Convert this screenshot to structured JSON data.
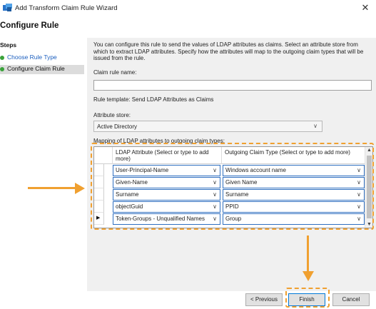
{
  "window": {
    "title": "Add Transform Claim Rule Wizard",
    "close_glyph": "✕",
    "icon": "wizard-app-icon"
  },
  "page": {
    "heading": "Configure Rule"
  },
  "steps": {
    "header": "Steps",
    "items": [
      {
        "label": "Choose Rule Type",
        "state": "completed"
      },
      {
        "label": "Configure Claim Rule",
        "state": "current"
      }
    ]
  },
  "content": {
    "description": "You can configure this rule to send the values of LDAP attributes as claims. Select an attribute store from which to extract LDAP attributes. Specify how the attributes will map to the outgoing claim types that will be issued from the rule.",
    "claim_rule_name_label": "Claim rule name:",
    "claim_rule_name_value": "",
    "rule_template_text": "Rule template: Send LDAP Attributes as Claims",
    "attribute_store_label": "Attribute store:",
    "attribute_store_value": "Active Directory",
    "mapping_label": "Mapping of LDAP attributes to outgoing claim types:",
    "grid": {
      "col_ldap": "LDAP Attribute (Select or type to add more)",
      "col_claim": "Outgoing Claim Type (Select or type to add more)",
      "rows": [
        {
          "ldap": "User-Principal-Name",
          "claim": "Windows account name",
          "current": false
        },
        {
          "ldap": "Given-Name",
          "claim": "Given Name",
          "current": false
        },
        {
          "ldap": "Surname",
          "claim": "Surname",
          "current": false
        },
        {
          "ldap": "objectGuid",
          "claim": "PPID",
          "current": false
        },
        {
          "ldap": "Token-Groups - Unqualified Names",
          "claim": "Group",
          "current": true
        }
      ]
    }
  },
  "buttons": {
    "previous": "< Previous",
    "finish": "Finish",
    "cancel": "Cancel"
  },
  "annotations": {
    "highlight_color": "#f0a030"
  },
  "glyphs": {
    "chevron": "∨",
    "row_arrow": "▶",
    "scroll_up": "▲",
    "scroll_down": "▼"
  }
}
